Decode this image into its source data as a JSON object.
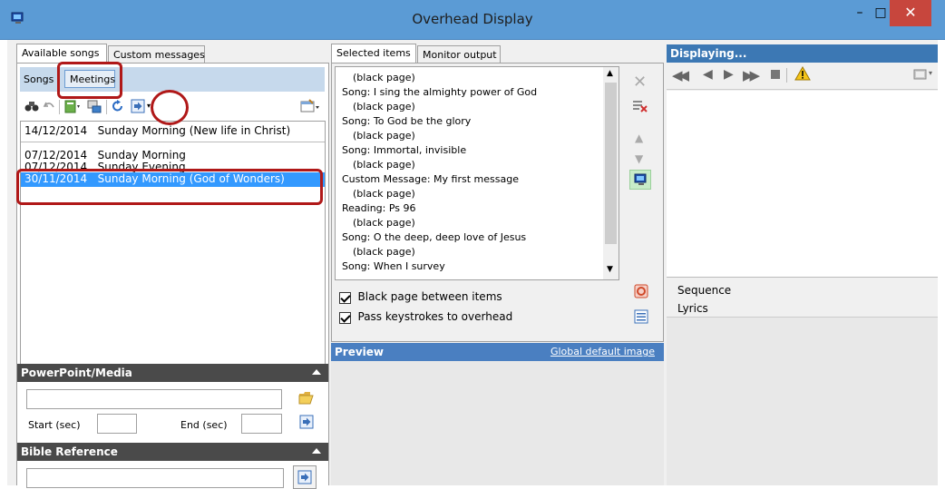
{
  "window": {
    "title": "Overhead Display",
    "minimize": "–",
    "maximize": "□",
    "close": "✕"
  },
  "left": {
    "tabs": [
      "Available songs",
      "Custom messages"
    ],
    "subtabs": [
      "Songs",
      "Meetings"
    ],
    "meetings": [
      {
        "date": "14/12/2014",
        "name": "Sunday Morning (New life in Christ)",
        "selected": false
      },
      {
        "date": "07/12/2014",
        "name": "Sunday Morning",
        "selected": false
      },
      {
        "date": "07/12/2014",
        "name": "Sunday Evening",
        "selected": false
      },
      {
        "date": "30/11/2014",
        "name": "Sunday Morning (God of Wonders)",
        "selected": true
      }
    ],
    "powerpoint_header": "PowerPoint/Media",
    "start_label": "Start (sec)",
    "end_label": "End (sec)",
    "bible_header": "Bible Reference"
  },
  "middle": {
    "tabs": [
      "Selected items",
      "Monitor output"
    ],
    "items": [
      {
        "text": "(black page)",
        "indent": true
      },
      {
        "text": "Song: I sing the almighty power of God",
        "indent": false
      },
      {
        "text": "(black page)",
        "indent": true
      },
      {
        "text": "Song: To God be the glory",
        "indent": false
      },
      {
        "text": "(black page)",
        "indent": true
      },
      {
        "text": "Song: Immortal, invisible",
        "indent": false
      },
      {
        "text": "(black page)",
        "indent": true
      },
      {
        "text": "Custom Message: My first message",
        "indent": false
      },
      {
        "text": "(black page)",
        "indent": true
      },
      {
        "text": "Reading: Ps 96",
        "indent": false
      },
      {
        "text": "(black page)",
        "indent": true
      },
      {
        "text": "Song: O the deep, deep love of Jesus",
        "indent": false
      },
      {
        "text": "(black page)",
        "indent": true
      },
      {
        "text": "Song: When I survey",
        "indent": false
      }
    ],
    "black_page_label": "Black page between items",
    "black_page_checked": true,
    "pass_keys_label": "Pass keystrokes to overhead",
    "pass_keys_checked": true,
    "preview_header": "Preview",
    "global_default_link": "Global default image"
  },
  "right": {
    "header": "Displaying...",
    "sequence_label": "Sequence",
    "lyrics_label": "Lyrics"
  },
  "colors": {
    "titlebar": "#5b9bd5",
    "selection": "#3399ff",
    "annotation": "#b01818",
    "close": "#c7463d"
  }
}
